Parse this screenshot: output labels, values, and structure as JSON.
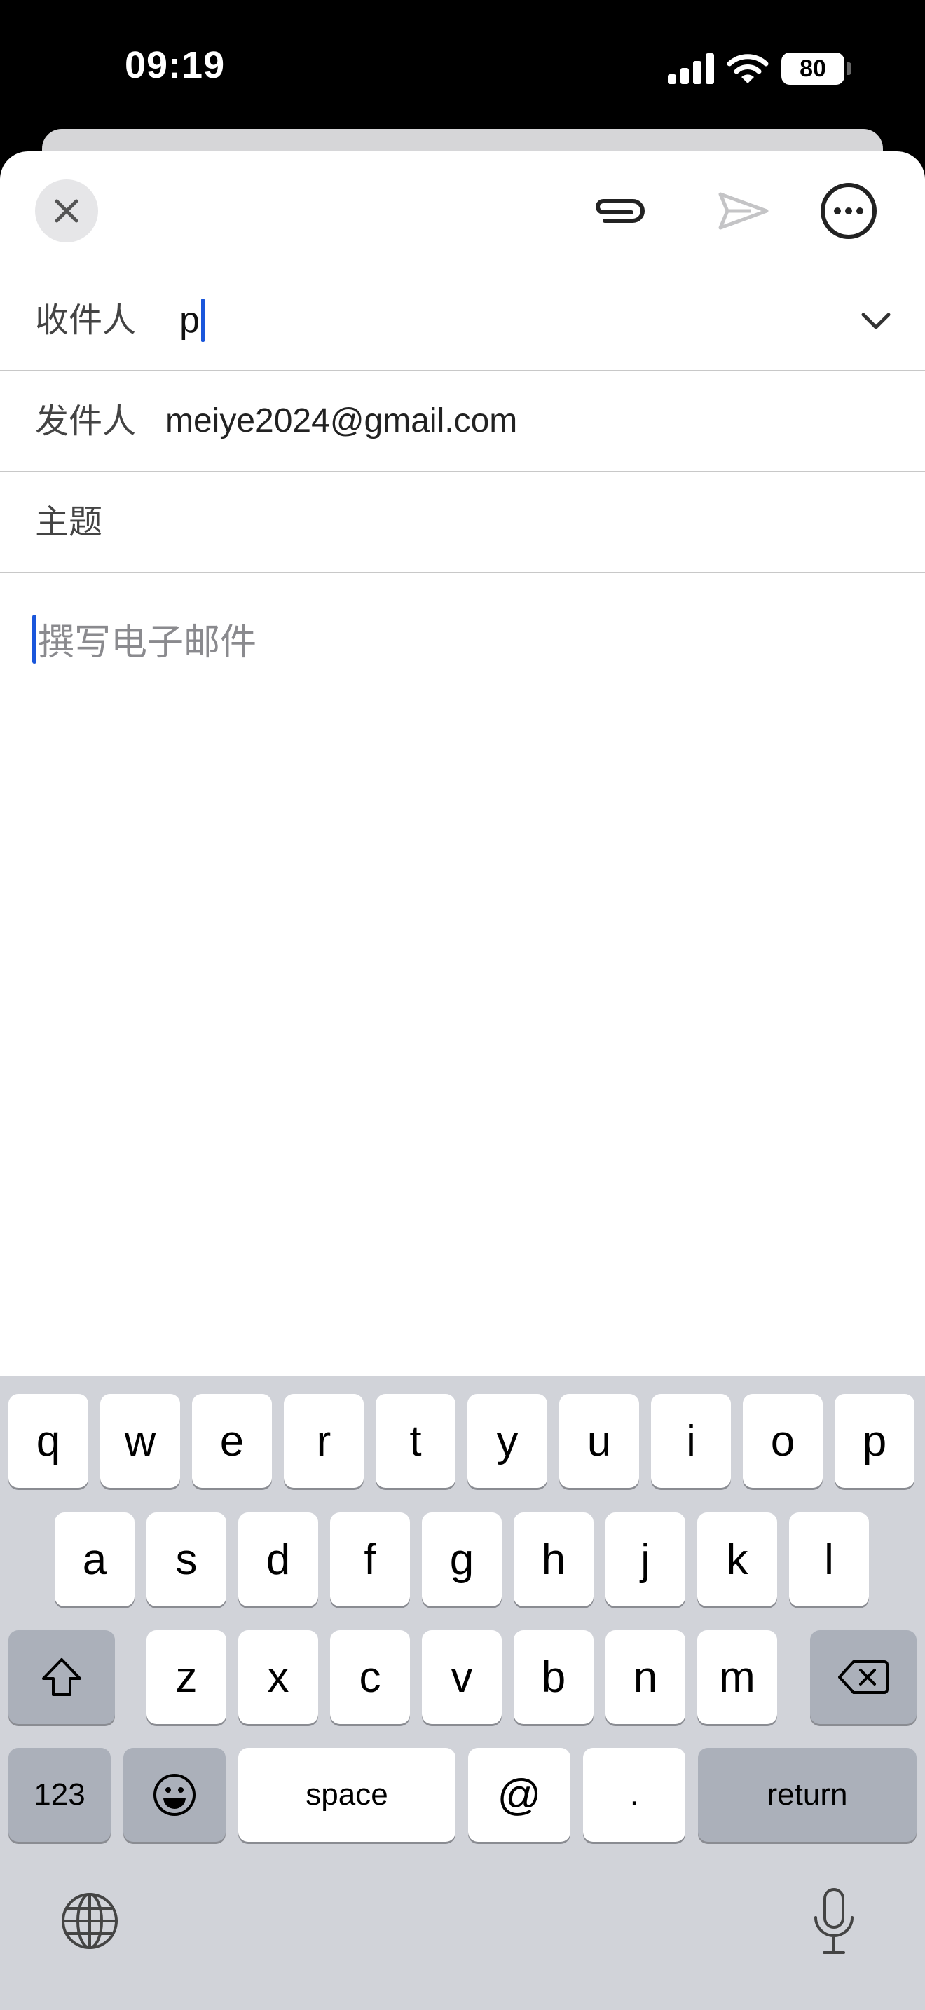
{
  "status_bar": {
    "time": "09:19",
    "battery": "80"
  },
  "compose": {
    "to_label": "收件人",
    "to_value": "p",
    "from_label": "发件人",
    "from_value": "meiye2024@gmail.com",
    "subject_label": "主题",
    "body_placeholder": "撰写电子邮件"
  },
  "keyboard": {
    "row1": [
      "q",
      "w",
      "e",
      "r",
      "t",
      "y",
      "u",
      "i",
      "o",
      "p"
    ],
    "row2": [
      "a",
      "s",
      "d",
      "f",
      "g",
      "h",
      "j",
      "k",
      "l"
    ],
    "row3": [
      "z",
      "x",
      "c",
      "v",
      "b",
      "n",
      "m"
    ],
    "numbers_label": "123",
    "space_label": "space",
    "at_label": "@",
    "dot_label": ".",
    "return_label": "return"
  },
  "colors": {
    "accent": "#1a56db",
    "keyboard_bg": "#d1d3d9",
    "dark_key": "#abb0ba"
  }
}
